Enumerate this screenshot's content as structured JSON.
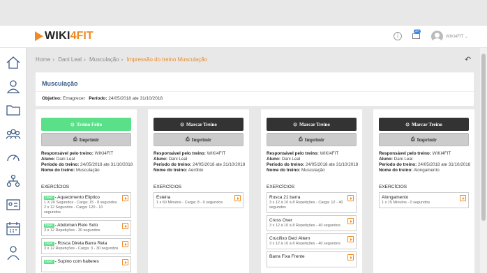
{
  "app": {
    "logo_left": "WIKI",
    "logo_right": "4FIT"
  },
  "header": {
    "info_icon": "info-icon",
    "mail_icon": "mail-icon",
    "mail_badge": "37",
    "user": "WIKI4FIT"
  },
  "breadcrumb": [
    "Home",
    "Dani Leal",
    "Musculação",
    "Impressão do treino Musculação"
  ],
  "breadcrumb_sep": "›",
  "page": {
    "title": "Musculação",
    "objetivo_label": "Objetivo:",
    "objetivo": "Emagrecer",
    "periodo_label": "Período:",
    "periodo": "24/05/2018 ate 31/10/2018"
  },
  "labels": {
    "resp": "Responsável pelo treino:",
    "aluno": "Aluno:",
    "periodo": "Período do treino:",
    "nome": "Nome do treino:",
    "exercicios": "EXERCÍCIOS",
    "imprimir": "Imprimir",
    "biset": "biset"
  },
  "cards": [
    {
      "action": "Treino Feito",
      "resp": "WIKI4FIT",
      "aluno": "Dani Leal",
      "periodo": "24/05/2018 ate 31/10/2018",
      "nome": "Musculação",
      "exercises": [
        {
          "name": "- Aquecimento Eliptico",
          "detail": "1 X 20 Segundos - Carga: 15 - 8 segundos 2 x 12 Segundos - Carga: 120 - 10 segundos",
          "biset": true
        },
        {
          "name": "- Abdomen Reto Solo",
          "detail": "3 x 12 Repetições - 30 segundos",
          "biset": true
        },
        {
          "name": "- Rosca Direta Barra Reta",
          "detail": "3 x 12 Repetições - Carga: 3 - 30 segundos",
          "biset": true
        },
        {
          "name": "- Supino com halteres",
          "detail": "",
          "biset": true
        }
      ]
    },
    {
      "action": "Marcar Treino",
      "resp": "WIKI4FIT",
      "aluno": "Dani Leal",
      "periodo": "24/05/2018 ate 31/10/2018",
      "nome": "Aeróbio",
      "exercises": [
        {
          "name": "Esteira",
          "detail": "1 x 60 Minutos - Carga: 8 - 0 segundos",
          "biset": false
        }
      ]
    },
    {
      "action": "Marcar Treino",
      "resp": "WIKI4FIT",
      "aluno": "Dani Leal",
      "periodo": "24/05/2018 ate 31/10/2018",
      "nome": "Musculação",
      "exercises": [
        {
          "name": "Rosca 21 barra",
          "detail": "3 x 12 à 10 à 8 Repetições - Carga: 12 - 40 segundos",
          "biset": false
        },
        {
          "name": "Cross Over",
          "detail": "3 x 12 à 10 à 8 Repetições - 40 segundos",
          "biset": false
        },
        {
          "name": "Crucifixo Decl Altern",
          "detail": "3 x 12 à 10 à 8 Repetições - 40 segundos",
          "biset": false
        },
        {
          "name": "Barra Fixa Frente",
          "detail": "",
          "biset": false
        }
      ]
    },
    {
      "action": "Marcar Treino",
      "resp": "WIKI4FIT",
      "aluno": "Dani Leal",
      "periodo": "24/05/2018 ate 31/10/2018",
      "nome": "Alongamento",
      "exercises": [
        {
          "name": "Alongamento",
          "detail": "1 x 15 Minutos - 0 segundos",
          "biset": false
        }
      ]
    }
  ],
  "sidebar_icons": [
    "home-icon",
    "user-icon",
    "folder-icon",
    "users-group-icon",
    "gauge-icon",
    "org-chart-icon",
    "id-card-icon",
    "calendar-icon",
    "user-bottom-icon"
  ],
  "colors": {
    "accent": "#f08a24",
    "primary": "#3c5a87",
    "done": "#5be08a",
    "dark": "#333333"
  }
}
